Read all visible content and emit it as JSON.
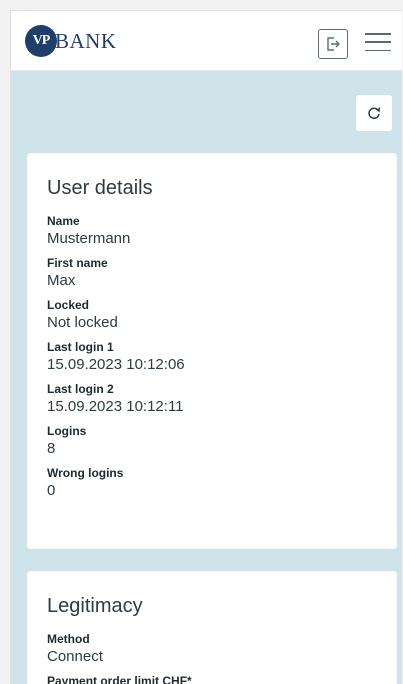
{
  "header": {
    "logo_mark": "VP",
    "logo_text": "BANK",
    "logout_icon": "logout-icon",
    "menu_icon": "hamburger-menu-icon"
  },
  "toolbar": {
    "refresh_icon": "refresh-icon"
  },
  "user_details": {
    "title": "User details",
    "fields": [
      {
        "label": "Name",
        "value": "Mustermann"
      },
      {
        "label": "First name",
        "value": "Max"
      },
      {
        "label": "Locked",
        "value": "Not locked"
      },
      {
        "label": "Last login 1",
        "value": "15.09.2023 10:12:06"
      },
      {
        "label": "Last login 2",
        "value": "15.09.2023 10:12:11"
      },
      {
        "label": "Logins",
        "value": "8"
      },
      {
        "label": "Wrong logins",
        "value": "0"
      }
    ]
  },
  "legitimacy": {
    "title": "Legitimacy",
    "fields": [
      {
        "label": "Method",
        "value": "Connect"
      },
      {
        "label": "Payment order limit CHF*",
        "value": ""
      }
    ]
  },
  "colors": {
    "brand": "#1f3e6c",
    "background": "#cfe3ea",
    "card": "#ffffff"
  }
}
